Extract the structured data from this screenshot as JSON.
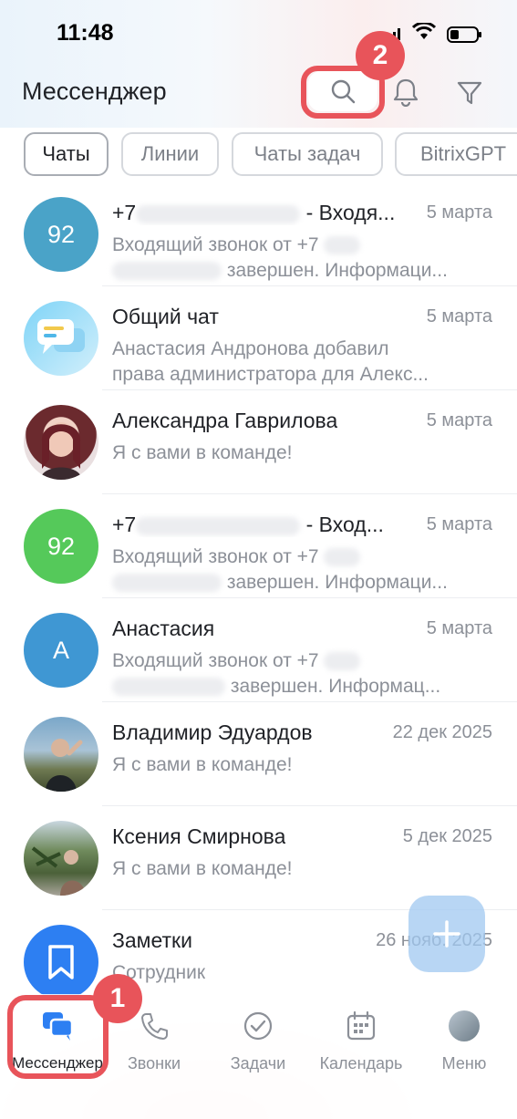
{
  "status_bar": {
    "time": "11:48"
  },
  "header": {
    "title": "Мессенджер"
  },
  "annotations": {
    "badge1": "1",
    "badge2": "2"
  },
  "tabs": [
    {
      "label": "Чаты",
      "active": true
    },
    {
      "label": "Линии"
    },
    {
      "label": "Чаты задач"
    },
    {
      "label": "BitrixGPT"
    }
  ],
  "chats": [
    {
      "avatar_text": "92",
      "avatar_color": "#4aa3c8",
      "name_prefix": "+7",
      "name_suffix": " - Входя...",
      "date": "5 марта",
      "preview_prefix": "Входящий звонок от +7",
      "preview_suffix": "завершен. Информаци..."
    },
    {
      "avatar_icon": "chat-bubbles-icon",
      "avatar_color": "#bfe6fa",
      "name": "Общий чат",
      "date": "5 марта",
      "preview_line1": "Анастасия Андронова добавил",
      "preview_line2": "права администратора для Алекс..."
    },
    {
      "avatar_icon": "user-photo",
      "avatar_color": "#c98a86",
      "name": "Александра Гаврилова",
      "date": "5 марта",
      "preview_line1": "Я с вами в команде!"
    },
    {
      "avatar_text": "92",
      "avatar_color": "#55c95a",
      "name_prefix": "+7",
      "name_suffix": " - Вход...",
      "date": "5 марта",
      "preview_prefix": "Входящий звонок от +7",
      "preview_suffix": "завершен. Информаци..."
    },
    {
      "avatar_text": "А",
      "avatar_color": "#3f97d3",
      "name": "Анастасия",
      "date": "5 марта",
      "preview_prefix": "Входящий звонок от +7",
      "preview_suffix": "завершен. Информац..."
    },
    {
      "avatar_icon": "user-photo",
      "avatar_color": "#7a8e9e",
      "name": "Владимир Эдуардов",
      "date": "22 дек 2025",
      "preview_line1": "Я с вами в команде!"
    },
    {
      "avatar_icon": "user-photo",
      "avatar_color": "#7f9a73",
      "name": "Ксения Смирнова",
      "date": "5 дек 2025",
      "preview_line1": "Я с вами в команде!"
    },
    {
      "avatar_icon": "bookmark-icon",
      "avatar_color": "#2d7ff2",
      "name": "Заметки",
      "date": "26 нояб. 2025",
      "preview_line1": "Сотрудник"
    }
  ],
  "bottom_nav": [
    {
      "label": "Мессенджер",
      "icon": "messenger-icon",
      "active": true
    },
    {
      "label": "Звонки",
      "icon": "phone-icon"
    },
    {
      "label": "Задачи",
      "icon": "check-circle-icon"
    },
    {
      "label": "Календарь",
      "icon": "calendar-icon"
    },
    {
      "label": "Меню",
      "icon": "avatar-icon"
    }
  ],
  "colors": {
    "accent": "#2d7ff2",
    "highlight": "#e8545a",
    "muted": "#8c9098"
  }
}
